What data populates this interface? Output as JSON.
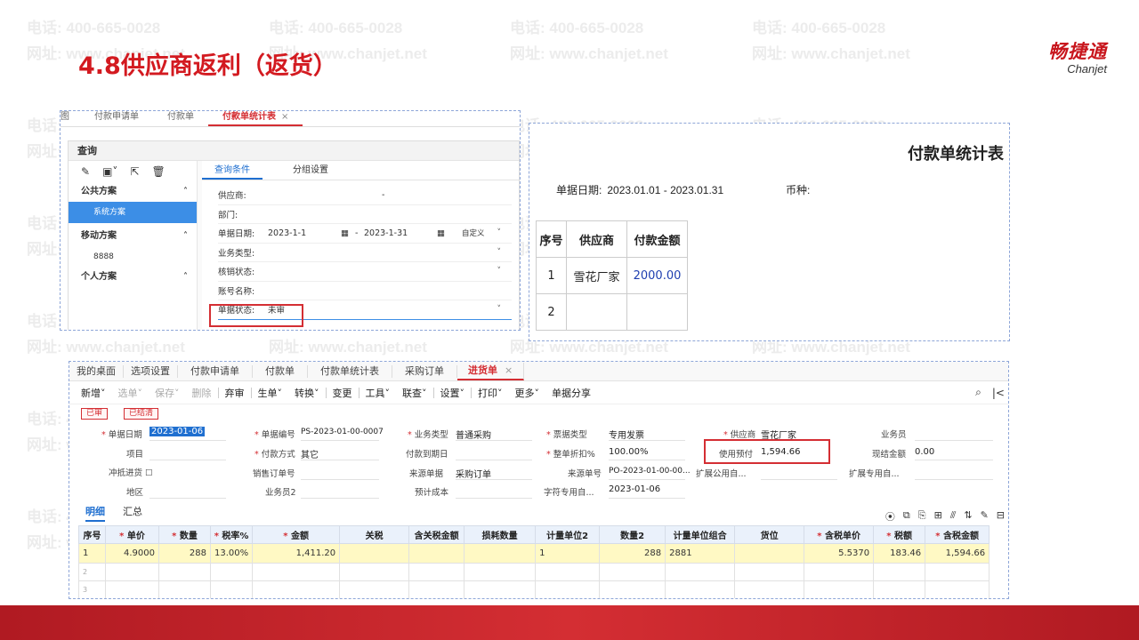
{
  "watermark": {
    "phone": "电话: 400-665-0028",
    "web": "网址: www.chanjet.net"
  },
  "slide": {
    "title": "4.8供应商返利（返货）"
  },
  "logo": {
    "cn": "畅捷通",
    "en": "Chanjet"
  },
  "query_panel": {
    "tabs": [
      {
        "label": "图"
      },
      {
        "label": "付款申请单"
      },
      {
        "label": "付款单"
      },
      {
        "label": "付款单统计表",
        "close": "×"
      }
    ],
    "header": "查询",
    "side_groups": [
      {
        "label": "公共方案",
        "items": [
          "系统方案"
        ]
      },
      {
        "label": "移动方案",
        "items": [
          "8888"
        ]
      },
      {
        "label": "个人方案",
        "items": []
      }
    ],
    "main_tabs": [
      "查询条件",
      "分组设置"
    ],
    "fields": [
      {
        "label": "供应商:",
        "value": "-"
      },
      {
        "label": "部门:",
        "value": ""
      },
      {
        "label": "单据日期:",
        "date_from": "2023-1-1",
        "date_to": "2023-1-31",
        "dash": "-",
        "extra": "自定义"
      },
      {
        "label": "业务类型:",
        "value": ""
      },
      {
        "label": "核销状态:",
        "value": ""
      },
      {
        "label": "账号名称:",
        "value": ""
      },
      {
        "label": "单据状态:",
        "value": "未审"
      }
    ]
  },
  "report": {
    "title": "付款单统计表",
    "date_label": "单据日期:",
    "date_value": "2023.01.01 - 2023.01.31",
    "currency_label": "币种:",
    "columns": [
      "序号",
      "供应商",
      "付款金额"
    ],
    "rows": [
      {
        "no": "1",
        "supplier": "雪花厂家",
        "amount": "2000.00"
      },
      {
        "no": "2",
        "supplier": "",
        "amount": ""
      }
    ]
  },
  "receipt": {
    "tabs": [
      "我的桌面",
      "选项设置",
      "付款申请单",
      "付款单",
      "付款单统计表",
      "采购订单",
      "进货单"
    ],
    "active_tab_close": "×",
    "toolbar": [
      "新增",
      "选单",
      "保存",
      "删除",
      "弃审",
      "生单",
      "转换",
      "变更",
      "工具",
      "联查",
      "设置",
      "打印",
      "更多",
      "单据分享"
    ],
    "badges": [
      "已审",
      "已结清"
    ],
    "fields": {
      "bill_date_label": "单据日期",
      "bill_date": "2023-01-06",
      "bill_no_label": "单据编号",
      "bill_no": "PS-2023-01-00-0007",
      "biz_type_label": "业务类型",
      "biz_type": "普通采购",
      "invoice_type_label": "票据类型",
      "invoice_type": "专用发票",
      "supplier_label": "供应商",
      "supplier": "雪花厂家",
      "salesman_label": "业务员",
      "project_label": "项目",
      "pay_method_label": "付款方式",
      "pay_method": "其它",
      "due_date_label": "付款到期日",
      "discount_label": "整单折扣%",
      "discount": "100.00%",
      "prepay_label": "使用预付",
      "prepay": "1,594.66",
      "cash_label": "现结金额",
      "cash": "0.00",
      "offset_label": "冲抵进货",
      "sales_order_label": "销售订单号",
      "source_bill_label": "来源单据",
      "source_bill": "采购订单",
      "source_no_label": "来源单号",
      "source_no": "PO-2023-01-00-00...",
      "ext_public_label": "扩展公用自...",
      "ext_private_label": "扩展专用自...",
      "region_label": "地区",
      "salesman2_label": "业务员2",
      "cost_label": "预计成本",
      "char_label": "字符专用自...",
      "char_value": "2023-01-06"
    },
    "detail_tabs": [
      "明细",
      "汇总"
    ],
    "grid_columns": [
      "序号",
      "单价",
      "数量",
      "税率%",
      "金额",
      "关税",
      "含关税金额",
      "损耗数量",
      "计量单位2",
      "数量2",
      "计量单位组合",
      "货位",
      "含税单价",
      "税额",
      "含税金额"
    ],
    "grid_rows": [
      {
        "no": "1",
        "price": "4.9000",
        "qty": "288",
        "tax_rate": "13.00%",
        "amount": "1,411.20",
        "unit2": "1",
        "qty2": "288",
        "unit_combo": "2881",
        "tax_price": "5.5370",
        "tax": "183.46",
        "tax_amount": "1,594.66"
      },
      {
        "no": "2"
      },
      {
        "no": "3"
      }
    ]
  }
}
